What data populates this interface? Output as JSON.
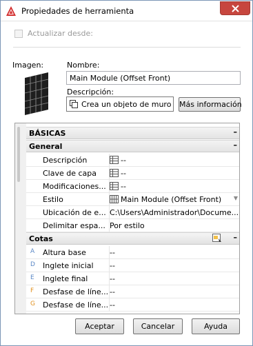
{
  "window": {
    "title": "Propiedades de herramienta"
  },
  "update": {
    "label": "Actualizar desde:"
  },
  "image": {
    "label": "Imagen:"
  },
  "name": {
    "label": "Nombre:",
    "value": "Main Module (Offset Front)"
  },
  "description": {
    "label": "Descripción:",
    "value": "Crea un objeto de muro c"
  },
  "more_info": {
    "label": "Más información"
  },
  "property_grid": {
    "basicas": {
      "label": "BÁSICAS",
      "collapse": "–"
    },
    "general": {
      "label": "General",
      "collapse": "–"
    },
    "general_rows": [
      {
        "label": "Descripción",
        "value": "--"
      },
      {
        "label": "Clave de capa",
        "value": "--"
      },
      {
        "label": "Modificaciones...",
        "value": "--"
      },
      {
        "label": "Estilo",
        "value": "Main Module (Offset Front)"
      },
      {
        "label": "Ubicación de e...",
        "value": "C:\\Users\\Administrador\\Docume..."
      },
      {
        "label": "Delimitar espa...",
        "value": "Por estilo"
      }
    ],
    "cotas": {
      "label": "Cotas",
      "collapse": "–"
    },
    "cotas_rows": [
      {
        "marker": "A",
        "label": "Altura base",
        "value": "--"
      },
      {
        "marker": "D",
        "label": "Inglete inicial",
        "value": "--"
      },
      {
        "marker": "E",
        "label": "Inglete final",
        "value": "--"
      },
      {
        "marker": "F",
        "label": "Desfase de líne...",
        "value": "--"
      },
      {
        "marker": "G",
        "label": "Desfase de líne...",
        "value": "--"
      }
    ]
  },
  "buttons": {
    "accept": "Aceptar",
    "cancel": "Cancelar",
    "help": "Ayuda"
  },
  "colors": {
    "accent_red": "#c7463e",
    "category_bg": "#e4e4e4",
    "marker_blue": "#5b88c6",
    "marker_orange": "#e1901f"
  }
}
